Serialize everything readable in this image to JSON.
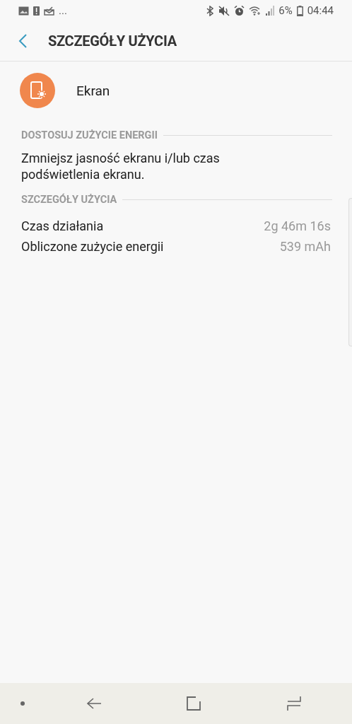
{
  "status_bar": {
    "more": "...",
    "battery_percent": "6%",
    "time": "04:44"
  },
  "header": {
    "title": "SZCZEGÓŁY UŻYCIA"
  },
  "app": {
    "name": "Ekran"
  },
  "sections": [
    {
      "kind": "tip",
      "title": "DOSTOSUJ ZUŻYCIE ENERGII",
      "text": "Zmniejsz jasność ekranu i/lub czas podświetlenia ekranu."
    },
    {
      "kind": "details",
      "title": "SZCZEGÓŁY UŻYCIA",
      "rows": [
        {
          "label": "Czas działania",
          "value": "2g 46m 16s"
        },
        {
          "label": "Obliczone zużycie energii",
          "value": "539 mAh"
        }
      ]
    }
  ]
}
